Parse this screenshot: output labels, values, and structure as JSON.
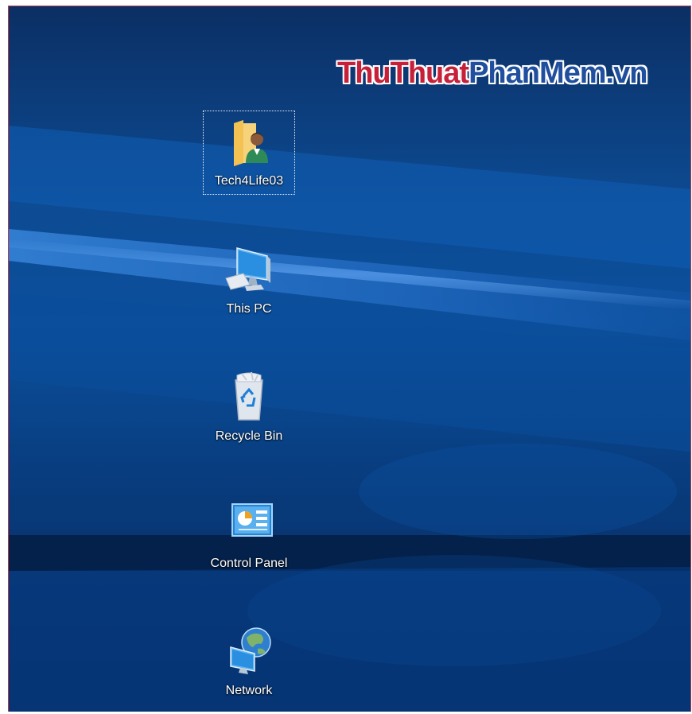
{
  "watermark": {
    "red_text": "ThuThuat",
    "blue_text": "PhanMem.vn"
  },
  "colors": {
    "desktop_top": "#0b2f64",
    "desktop_mid": "#0d4b93",
    "desktop_bottom": "#062c63",
    "watermark_red": "#c7213a",
    "watermark_blue": "#1f4f9e"
  },
  "desktop_icons": [
    {
      "label": "Tech4Life03",
      "icon": "user-folder-icon",
      "selected": true
    },
    {
      "label": "This PC",
      "icon": "computer-icon",
      "selected": false
    },
    {
      "label": "Recycle Bin",
      "icon": "recycle-bin-icon",
      "selected": false
    },
    {
      "label": "Control Panel",
      "icon": "control-panel-icon",
      "selected": false
    },
    {
      "label": "Network",
      "icon": "network-icon",
      "selected": false
    }
  ]
}
